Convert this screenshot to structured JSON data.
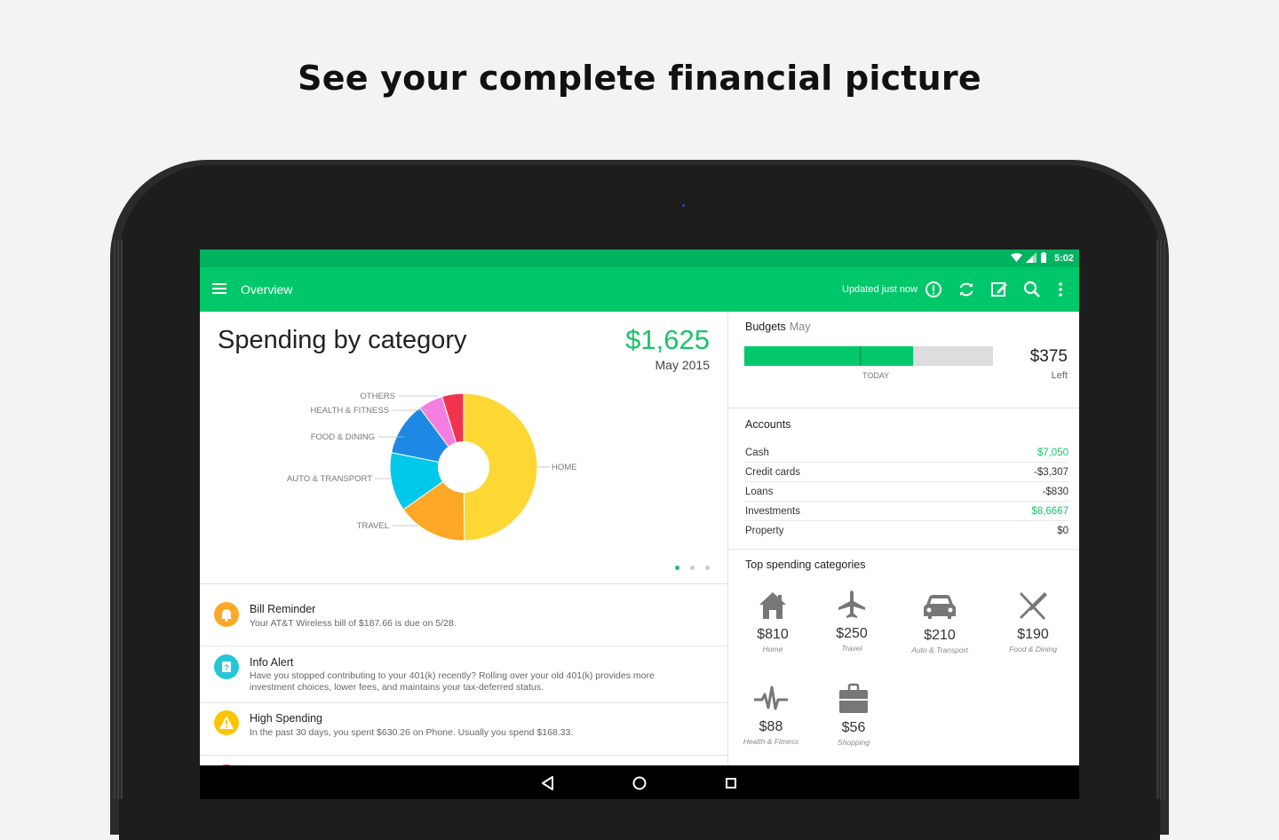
{
  "headline": "See your complete financial picture",
  "status": {
    "time": "5:02"
  },
  "appbar": {
    "title": "Overview",
    "updated": "Updated just now"
  },
  "spending": {
    "title": "Spending by category",
    "amount": "$1,625",
    "date": "May 2015",
    "labels": {
      "others": "OTHERS",
      "health": "HEALTH & FITNESS",
      "food": "FOOD & DINING",
      "auto": "AUTO & TRANSPORT",
      "travel": "TRAVEL",
      "home": "HOME"
    },
    "slices": [
      {
        "name": "HOME",
        "value": 810,
        "color": "#FDD835"
      },
      {
        "name": "TRAVEL",
        "value": 250,
        "color": "#FFA726"
      },
      {
        "name": "AUTO & TRANSPORT",
        "value": 210,
        "color": "#00C8E8"
      },
      {
        "name": "FOOD & DINING",
        "value": 190,
        "color": "#1E88E5"
      },
      {
        "name": "HEALTH & FITNESS",
        "value": 88,
        "color": "#F57FE0"
      },
      {
        "name": "OTHERS",
        "value": 77,
        "color": "#F0334F"
      }
    ]
  },
  "alerts": [
    {
      "title": "Bill Reminder",
      "body": "Your AT&T Wireless bill of $187.66 is due on 5/28.",
      "color": "#FFA726",
      "icon": "bell-icon"
    },
    {
      "title": "Info Alert",
      "body": "Have you stopped contributing to your 401(k) recently? Rolling over your old 401(k) provides more investment choices, lower fees, and maintains your tax-deferred status.",
      "color": "#26C6DA",
      "icon": "question-icon"
    },
    {
      "title": "High Spending",
      "body": "In the past 30 days, you spent $630.26 on Phone.  Usually you spend $168.33.",
      "color": "#FFC400",
      "icon": "warning-icon"
    }
  ],
  "budgets": {
    "label": "Budgets",
    "month": "May",
    "today": "TODAY",
    "amount": "$375",
    "left": "Left",
    "progress": 0.68
  },
  "accounts": {
    "title": "Accounts",
    "rows": [
      {
        "name": "Cash",
        "value": "$7,050",
        "positive": true
      },
      {
        "name": "Credit cards",
        "value": "-$3,307",
        "positive": false
      },
      {
        "name": "Loans",
        "value": "-$830",
        "positive": false
      },
      {
        "name": "Investments",
        "value": "$8,6667",
        "positive": true
      },
      {
        "name": "Property",
        "value": "$0",
        "positive": false
      }
    ]
  },
  "top_spending": {
    "title": "Top spending categories",
    "items": [
      {
        "amount": "$810",
        "label": "Home",
        "icon": "house-icon"
      },
      {
        "amount": "$250",
        "label": "Travel",
        "icon": "airplane-icon"
      },
      {
        "amount": "$210",
        "label": "Auto & Transport",
        "icon": "car-icon"
      },
      {
        "amount": "$190",
        "label": "Food & Dining",
        "icon": "fork-knife-icon"
      },
      {
        "amount": "$88",
        "label": "Health & Fitness",
        "icon": "heartbeat-icon"
      },
      {
        "amount": "$56",
        "label": "Shopping",
        "icon": "shopping-bag-icon"
      }
    ]
  },
  "colors": {
    "accent": "#00C86A",
    "positive": "#1CC26A",
    "statusbar": "#00B35F"
  }
}
